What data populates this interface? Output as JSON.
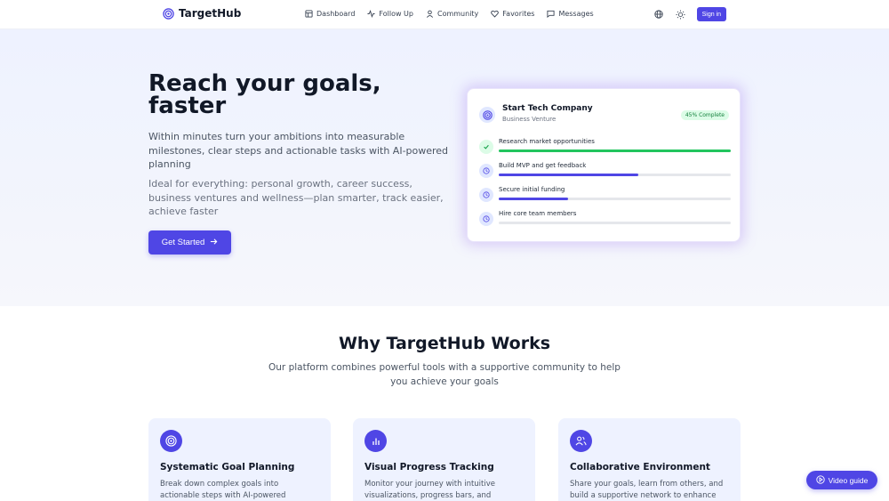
{
  "header": {
    "brand": "TargetHub",
    "nav": [
      {
        "label": "Dashboard",
        "icon": "dashboard-icon"
      },
      {
        "label": "Follow Up",
        "icon": "activity-icon"
      },
      {
        "label": "Community",
        "icon": "user-icon"
      },
      {
        "label": "Favorites",
        "icon": "heart-icon"
      },
      {
        "label": "Messages",
        "icon": "message-icon"
      }
    ],
    "sign_in": "Sign in"
  },
  "hero": {
    "title": "Reach your goals, faster",
    "p1": "Within minutes turn your ambitions into measurable milestones, clear steps and actionable tasks with AI-powered planning",
    "p2": "Ideal for everything: personal growth, career success, business ventures and wellness—plan smarter, track easier, achieve faster",
    "cta": "Get Started"
  },
  "goal_card": {
    "title": "Start Tech Company",
    "subtitle": "Business Venture",
    "badge": "45% Complete",
    "tasks": [
      {
        "label": "Research market opportunities",
        "progress": 1.0,
        "status": "done"
      },
      {
        "label": "Build MVP and get feedback",
        "progress": 0.6,
        "status": "pending"
      },
      {
        "label": "Secure initial funding",
        "progress": 0.3,
        "status": "pending"
      },
      {
        "label": "Hire core team members",
        "progress": 0.0,
        "status": "pending"
      }
    ]
  },
  "why": {
    "title": "Why TargetHub Works",
    "subtitle": "Our platform combines powerful tools with a supportive community to help you achieve your goals",
    "features": [
      {
        "title": "Systematic Goal Planning",
        "desc": "Break down complex goals into actionable steps with AI-powered suggestions to",
        "icon": "target-icon"
      },
      {
        "title": "Visual Progress Tracking",
        "desc": "Monitor your journey with intuitive visualizations, progress bars, and",
        "icon": "bar-chart-icon"
      },
      {
        "title": "Collaborative Environment",
        "desc": "Share your goals, learn from others, and build a supportive network to enhance",
        "icon": "users-icon"
      }
    ]
  },
  "video_guide": "Video guide",
  "colors": {
    "accent": "#4f46e5",
    "success": "#22c55e"
  }
}
